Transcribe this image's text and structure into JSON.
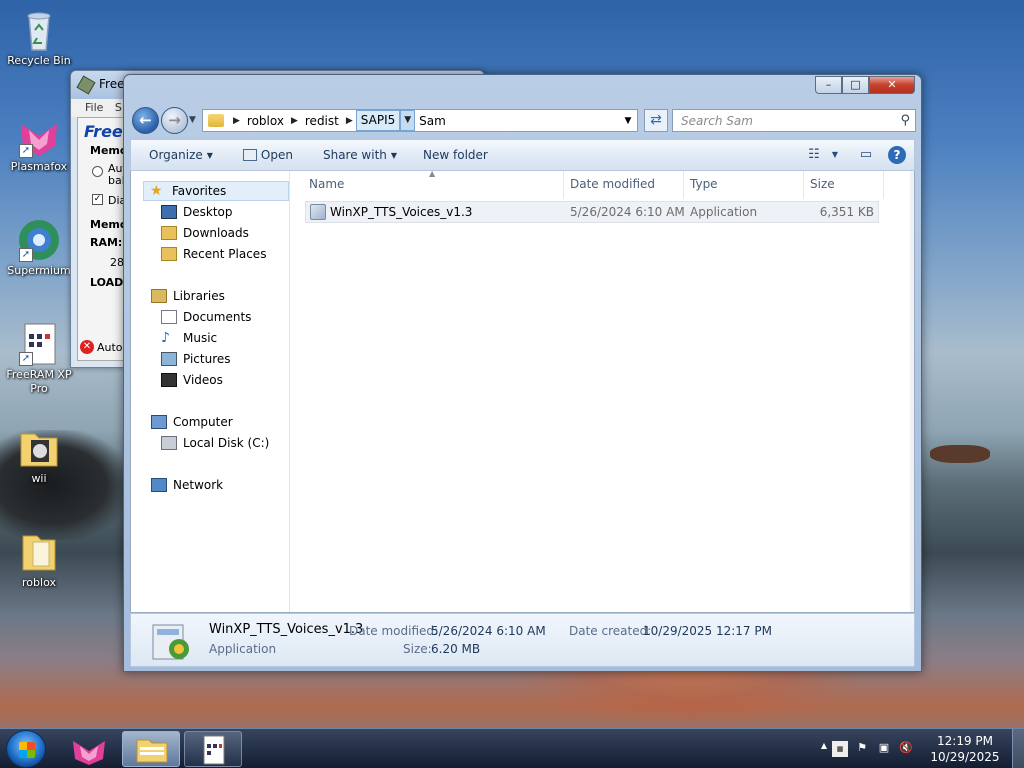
{
  "desktop": {
    "icons": [
      {
        "label": "Recycle Bin"
      },
      {
        "label": "Plasmafox"
      },
      {
        "label": "Supermium"
      },
      {
        "label": "FreeRAM XP Pro"
      },
      {
        "label": "wii"
      },
      {
        "label": "roblox"
      }
    ]
  },
  "back_window": {
    "title": "Free",
    "menu_file": "File",
    "menu_second": "S",
    "brand": "FreeF",
    "memo1": "Memo",
    "opt1a": "Aut",
    "opt1b": "bal",
    "opt2": "Dia",
    "memo2": "Memo",
    "ram_label": "RAM:",
    "ram_value": "28",
    "load": "LOAD",
    "auto": "Auto"
  },
  "explorer": {
    "controls": {
      "minimize": "–",
      "maximize": "□",
      "close": "✕"
    },
    "address": {
      "crumbs": [
        "roblox",
        "redist",
        "SAPI5",
        "Sam"
      ]
    },
    "search": {
      "placeholder": "Search Sam"
    },
    "toolbar": {
      "organize": "Organize",
      "open": "Open",
      "share_with": "Share with",
      "new_folder": "New folder"
    },
    "nav": {
      "favorites": "Favorites",
      "desktop": "Desktop",
      "downloads": "Downloads",
      "recent_places": "Recent Places",
      "libraries": "Libraries",
      "documents": "Documents",
      "music": "Music",
      "pictures": "Pictures",
      "videos": "Videos",
      "computer": "Computer",
      "local_disk": "Local Disk (C:)",
      "network": "Network"
    },
    "columns": {
      "name": "Name",
      "date_modified": "Date modified",
      "type": "Type",
      "size": "Size"
    },
    "files": [
      {
        "name": "WinXP_TTS_Voices_v1.3",
        "date_modified": "5/26/2024 6:10 AM",
        "type": "Application",
        "size": "6,351 KB"
      }
    ],
    "details": {
      "name": "WinXP_TTS_Voices_v1.3",
      "type": "Application",
      "date_modified_label": "Date modified:",
      "date_modified": "5/26/2024 6:10 AM",
      "size_label": "Size:",
      "size": "6.20 MB",
      "date_created_label": "Date created:",
      "date_created": "10/29/2025 12:17 PM"
    }
  },
  "taskbar": {
    "time": "12:19 PM",
    "date": "10/29/2025"
  }
}
